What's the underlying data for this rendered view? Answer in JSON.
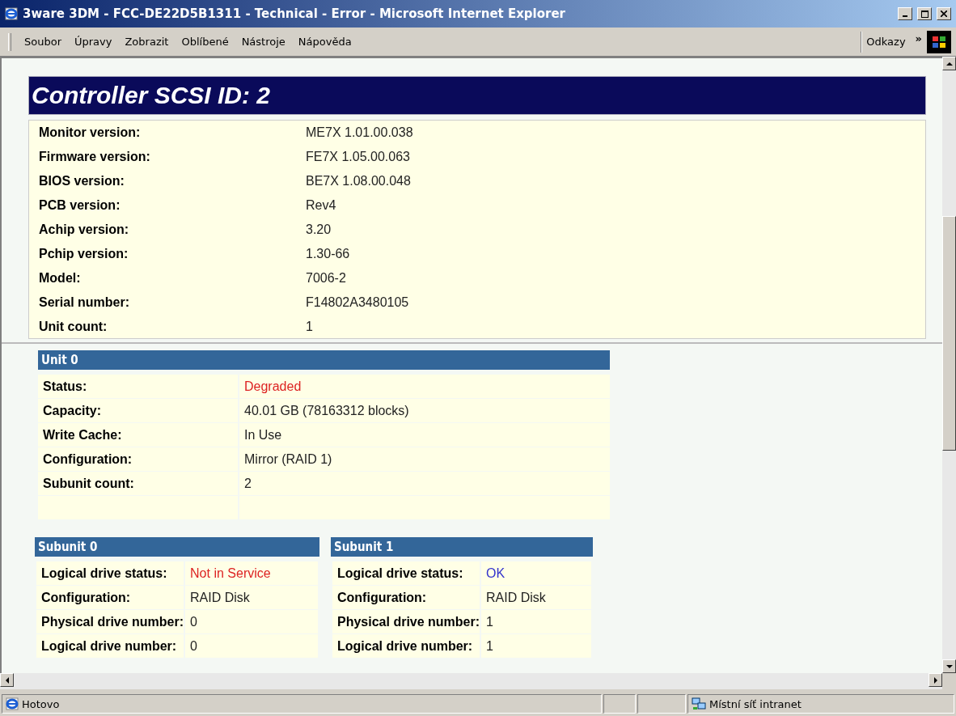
{
  "window": {
    "title": "3ware 3DM - FCC-DE22D5B1311 - Technical - Error - Microsoft Internet Explorer"
  },
  "menu": [
    "Soubor",
    "Úpravy",
    "Zobrazit",
    "Oblíbené",
    "Nástroje",
    "Nápověda"
  ],
  "links_label": "Odkazy",
  "links_chevron": "»",
  "heading": "Controller SCSI ID: 2",
  "controller": [
    {
      "label": "Monitor version:",
      "value": "ME7X 1.01.00.038"
    },
    {
      "label": "Firmware version:",
      "value": "FE7X 1.05.00.063"
    },
    {
      "label": "BIOS version:",
      "value": "BE7X 1.08.00.048"
    },
    {
      "label": "PCB version:",
      "value": "Rev4"
    },
    {
      "label": "Achip version:",
      "value": "3.20"
    },
    {
      "label": "Pchip version:",
      "value": "1.30-66"
    },
    {
      "label": "Model:",
      "value": "7006-2"
    },
    {
      "label": "Serial number:",
      "value": "F14802A3480105"
    },
    {
      "label": "Unit count:",
      "value": "1"
    }
  ],
  "unit": {
    "title": "Unit 0",
    "rows": [
      {
        "label": "Status:",
        "value": "Degraded",
        "color": "#dd2222"
      },
      {
        "label": "Capacity:",
        "value": "40.01 GB (78163312 blocks)"
      },
      {
        "label": "Write Cache:",
        "value": "In Use"
      },
      {
        "label": "Configuration:",
        "value": "Mirror (RAID 1)"
      },
      {
        "label": "Subunit count:",
        "value": "2"
      }
    ],
    "subunits": [
      {
        "title": "Subunit 0",
        "rows": [
          {
            "label": "Logical drive status:",
            "value": "Not in Service",
            "color": "#dd2222"
          },
          {
            "label": "Configuration:",
            "value": "RAID Disk"
          },
          {
            "label": "Physical drive number:",
            "value": "0"
          },
          {
            "label": "Logical drive number:",
            "value": "0"
          }
        ]
      },
      {
        "title": "Subunit 1",
        "rows": [
          {
            "label": "Logical drive status:",
            "value": "OK",
            "color": "#3333cc"
          },
          {
            "label": "Configuration:",
            "value": "RAID Disk"
          },
          {
            "label": "Physical drive number:",
            "value": "1"
          },
          {
            "label": "Logical drive number:",
            "value": "1"
          }
        ]
      }
    ]
  },
  "status_bar": {
    "text": "Hotovo",
    "zone": "Místní síť intranet"
  }
}
